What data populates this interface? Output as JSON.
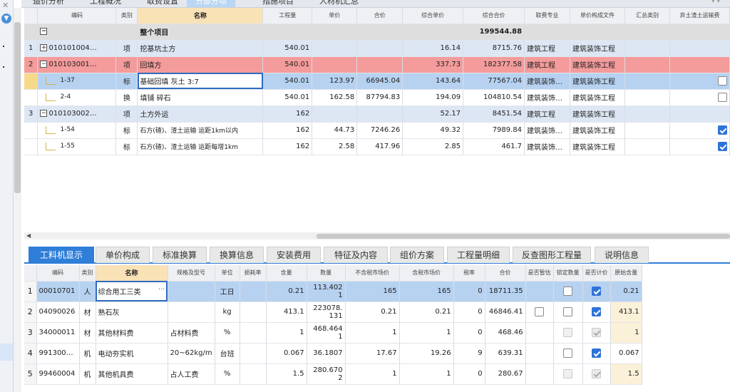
{
  "top_tabs": [
    "造价分析",
    "工程概况",
    "取费设置",
    "分部分项",
    "措施项目",
    "人材机汇总"
  ],
  "grid1": {
    "headers": [
      "编码",
      "类别",
      "名称",
      "工程量",
      "单价",
      "合价",
      "综合单价",
      "综合合价",
      "取费专业",
      "单价构成文件",
      "汇总类别",
      "弃土渣土运输费"
    ],
    "project_row": {
      "label": "整个项目",
      "total": "199544.88"
    },
    "rows": [
      {
        "rownum": "1",
        "code": "010101004…",
        "cat": "项",
        "name": "挖基坑土方",
        "qty": "540.01",
        "price": "",
        "amount": "",
        "uprice": "16.14",
        "utotal": "8715.76",
        "fee": "建筑工程",
        "file": "建筑装饰工程",
        "sum": ""
      },
      {
        "rownum": "2",
        "code": "010103001…",
        "cat": "项",
        "name": "回填方",
        "qty": "540.01",
        "price": "",
        "amount": "",
        "uprice": "337.73",
        "utotal": "182377.58",
        "fee": "建筑工程",
        "file": "建筑装饰工程",
        "sum": ""
      },
      {
        "rownum": "",
        "code": "1-37",
        "cat": "标",
        "name": "基础回填 灰土 3:7",
        "qty": "540.01",
        "price": "123.97",
        "amount": "66945.04",
        "uprice": "143.64",
        "utotal": "77567.04",
        "fee": "建筑装饰…",
        "file": "建筑装饰工程",
        "sum": ""
      },
      {
        "rownum": "",
        "code": "2-4",
        "cat": "换",
        "name": "填铺 碎石",
        "qty": "540.01",
        "price": "162.58",
        "amount": "87794.83",
        "uprice": "194.09",
        "utotal": "104810.54",
        "fee": "建筑装饰…",
        "file": "建筑装饰工程",
        "sum": ""
      },
      {
        "rownum": "3",
        "code": "010103002…",
        "cat": "项",
        "name": "土方外运",
        "qty": "162",
        "price": "",
        "amount": "",
        "uprice": "52.17",
        "utotal": "8451.54",
        "fee": "建筑工程",
        "file": "建筑装饰工程",
        "sum": ""
      },
      {
        "rownum": "",
        "code": "1-54",
        "cat": "标",
        "name": "石方(碴)、渣土运输 运距1km以内",
        "qty": "162",
        "price": "44.73",
        "amount": "7246.26",
        "uprice": "49.32",
        "utotal": "7989.84",
        "fee": "建筑装饰…",
        "file": "建筑装饰工程",
        "sum": ""
      },
      {
        "rownum": "",
        "code": "1-55",
        "cat": "标",
        "name": "石方(碴)、渣土运输 运距每增1km",
        "qty": "162",
        "price": "2.58",
        "amount": "417.96",
        "uprice": "2.85",
        "utotal": "461.7",
        "fee": "建筑装饰…",
        "file": "建筑装饰工程",
        "sum": ""
      }
    ]
  },
  "bottom_tabs": [
    "工料机显示",
    "单价构成",
    "标准换算",
    "换算信息",
    "安装费用",
    "特征及内容",
    "组价方案",
    "工程量明细",
    "反查图形工程量",
    "说明信息"
  ],
  "grid2": {
    "headers": [
      "编码",
      "类别",
      "名称",
      "规格及型号",
      "单位",
      "损耗率",
      "含量",
      "数量",
      "不含税市场价",
      "含税市场价",
      "税率",
      "合价",
      "是否暂估",
      "锁定数量",
      "是否计价",
      "原始含量"
    ],
    "rows": [
      {
        "rownum": "1",
        "code": "00010701",
        "cat": "人",
        "name": "综合用工三类",
        "spec": "",
        "unit": "工日",
        "loss": "",
        "content": "0.21",
        "qty": "113.4021",
        "pnt": "165",
        "pt": "165",
        "tax": "0",
        "amount": "18711.35",
        "orig": "0.21"
      },
      {
        "rownum": "2",
        "code": "04090026",
        "cat": "材",
        "name": "熟石灰",
        "spec": "",
        "unit": "kg",
        "loss": "",
        "content": "413.1",
        "qty": "223078.131",
        "pnt": "0.21",
        "pt": "0.21",
        "tax": "0",
        "amount": "46846.41",
        "orig": "413.1"
      },
      {
        "rownum": "3",
        "code": "34000011",
        "cat": "材",
        "name": "其他材料费",
        "spec": "占材料费",
        "unit": "%",
        "loss": "",
        "content": "1",
        "qty": "468.4641",
        "pnt": "1",
        "pt": "1",
        "tax": "0",
        "amount": "468.46",
        "orig": "1"
      },
      {
        "rownum": "4",
        "code": "991300…",
        "cat": "机",
        "name": "电动夯实机",
        "spec": "20~62kg/m",
        "unit": "台班",
        "loss": "",
        "content": "0.067",
        "qty": "36.1807",
        "pnt": "17.67",
        "pt": "19.26",
        "tax": "9",
        "amount": "639.31",
        "orig": "0.067"
      },
      {
        "rownum": "5",
        "code": "99460004",
        "cat": "机",
        "name": "其他机具费",
        "spec": "占人工费",
        "unit": "%",
        "loss": "",
        "content": "1.5",
        "qty": "280.6702",
        "pnt": "1",
        "pt": "1",
        "tax": "0",
        "amount": "280.67",
        "orig": "1.5"
      }
    ]
  }
}
